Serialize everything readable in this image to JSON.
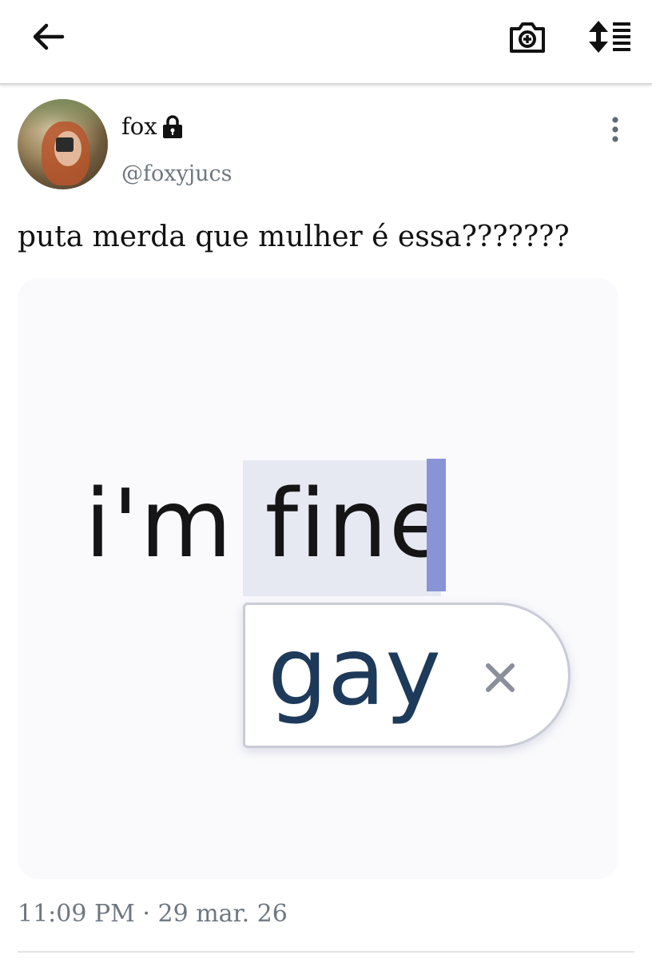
{
  "tweet": {
    "display_name": "fox",
    "handle": "@foxyjucs",
    "text": "puta merda que mulher é essa???????",
    "timestamp": "11:09 PM · 29 mar. 26"
  },
  "media": {
    "typed_text": "i'm fine",
    "suggestion": "gay",
    "dismiss_symbol": "×"
  },
  "icons": {
    "back": "arrow-left-icon",
    "camera": "camera-plus-icon",
    "sort": "sort-arrows-icon",
    "lock": "lock-icon",
    "more": "more-vertical-icon"
  }
}
